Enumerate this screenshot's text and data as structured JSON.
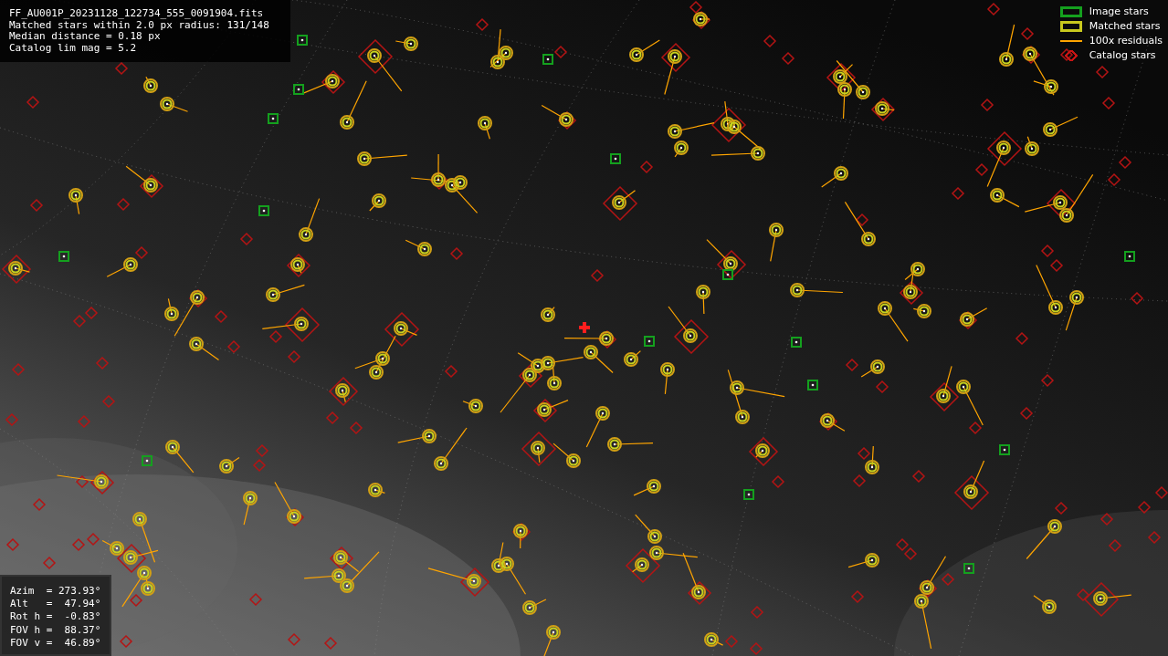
{
  "file_info": {
    "lines": [
      "FF_AU001P_20231128_122734_555_0091904.fits",
      "Matched stars within 2.0 px radius: 131/148",
      "Median distance = 0.18 px",
      "Catalog lim mag = 5.2"
    ]
  },
  "legend": [
    {
      "label": "Image stars",
      "kind": "box",
      "color": "#14a01e"
    },
    {
      "label": "Matched stars",
      "kind": "box",
      "color": "#c8c81e"
    },
    {
      "label": "100x residuals",
      "kind": "line",
      "color": "#ffa500"
    },
    {
      "label": "Catalog stars",
      "kind": "diamond",
      "color": "#c81414"
    }
  ],
  "pointing_info": {
    "lines": [
      "Azim  = 273.93°",
      "Alt   =  47.94°",
      "Rot h =  -0.83°",
      "FOV h =  88.37°",
      "FOV v =  46.89°"
    ]
  }
}
